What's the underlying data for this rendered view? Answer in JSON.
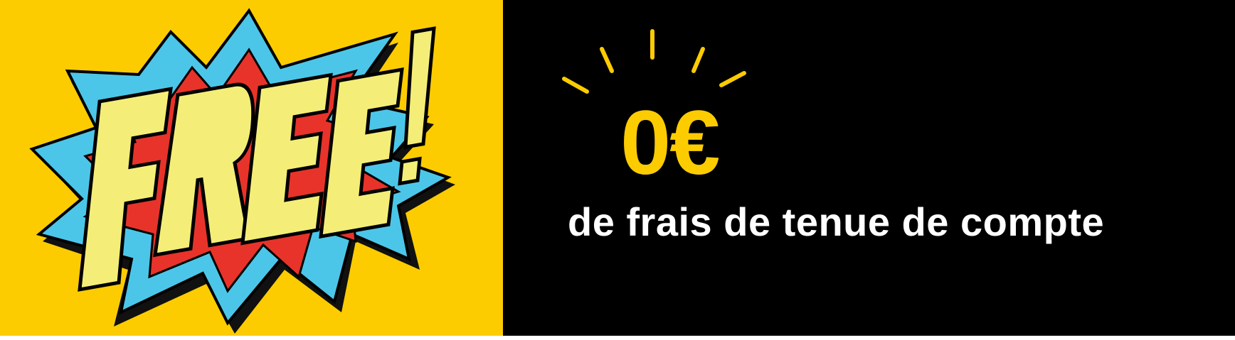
{
  "banner": {
    "logo_text": "FREE!",
    "price": "0€",
    "subtitle": "de frais de tenue de compte"
  },
  "colors": {
    "yellow": "#fccc00",
    "black": "#000000",
    "blue": "#4cc6e8",
    "red": "#e8332a",
    "pale_yellow": "#f4ee78"
  }
}
